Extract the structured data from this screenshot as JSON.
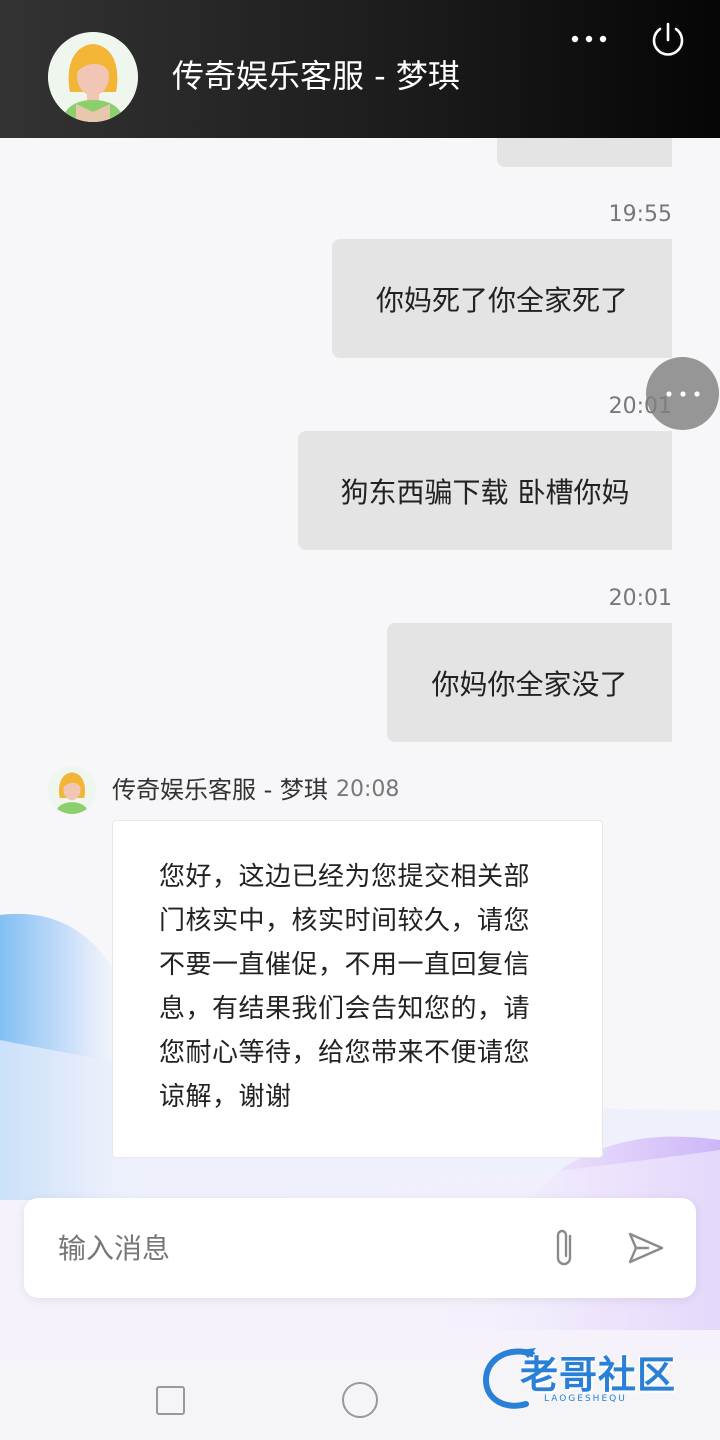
{
  "header": {
    "title": "传奇娱乐客服 - 梦琪"
  },
  "messages_out": [
    {
      "time": "19:55",
      "text": "你妈死了你全家死了"
    },
    {
      "time": "20:01",
      "text": "狗东西骗下载 卧槽你妈"
    },
    {
      "time": "20:01",
      "text": "你妈你全家没了"
    }
  ],
  "agent_message": {
    "name": "传奇娱乐客服 - 梦琪",
    "time": "20:08",
    "lines": [
      "您好，这边已经为您提交相关部",
      "门核实中，核实时间较久，请您",
      "不要一直催促，不用一直回复信",
      "息，有结果我们会告知您的，请",
      "您耐心等待，给您带来不便请您",
      "谅解，谢谢"
    ]
  },
  "input": {
    "placeholder": "输入消息"
  },
  "watermark": {
    "text": "老哥社区",
    "sub": "LAOGESHEQU"
  },
  "colors": {
    "header_bg": "#1a1a1a",
    "bubble_out": "#e4e4e4",
    "bubble_in": "#ffffff",
    "watermark": "#2a7fd6"
  }
}
